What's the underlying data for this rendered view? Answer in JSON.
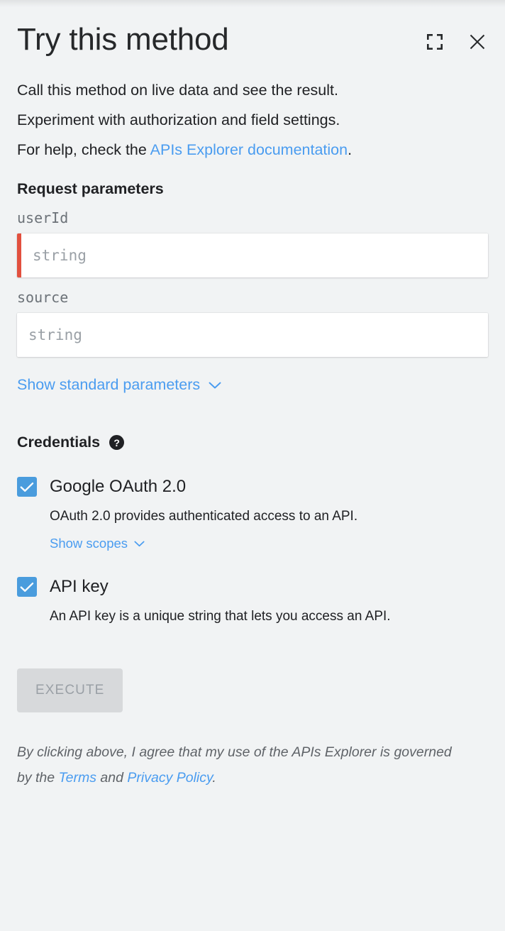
{
  "header": {
    "title": "Try this method",
    "fullscreen_icon": "fullscreen-expand-icon",
    "close_icon": "close-icon"
  },
  "description": {
    "line1": "Call this method on live data and see the result.",
    "line2": "Experiment with authorization and field settings.",
    "line3_prefix": "For help, check the ",
    "link_text": "APIs Explorer documentation",
    "line3_suffix": "."
  },
  "request_parameters": {
    "heading": "Request parameters",
    "fields": [
      {
        "name": "userId",
        "value": "",
        "placeholder": "string",
        "required": true
      },
      {
        "name": "source",
        "value": "",
        "placeholder": "string",
        "required": false
      }
    ],
    "show_standard_label": "Show standard parameters",
    "chevron_icon": "chevron-down-icon"
  },
  "credentials": {
    "heading": "Credentials",
    "help_icon": "help-question-icon",
    "help_glyph": "?",
    "items": [
      {
        "label": "Google OAuth 2.0",
        "checked": true,
        "description": "OAuth 2.0 provides authenticated access to an API.",
        "sub_link": "Show scopes"
      },
      {
        "label": "API key",
        "checked": true,
        "description": "An API key is a unique string that lets you access an API.",
        "sub_link": null
      }
    ]
  },
  "execute": {
    "label": "EXECUTE",
    "disabled": true
  },
  "footer": {
    "part1": "By clicking above, I agree that my use of the APIs Explorer is governed by the ",
    "terms_link": "Terms",
    "part2": " and ",
    "privacy_link": "Privacy Policy",
    "part3": "."
  },
  "colors": {
    "background": "#f1f3f4",
    "link": "#4a9cf0",
    "accent_checkbox": "#4a9cdd",
    "required_bar": "#e2503e",
    "text_primary": "#202124",
    "text_secondary": "#5f6368",
    "button_disabled_bg": "#d7d9db",
    "button_disabled_text": "#9aa0a6"
  }
}
